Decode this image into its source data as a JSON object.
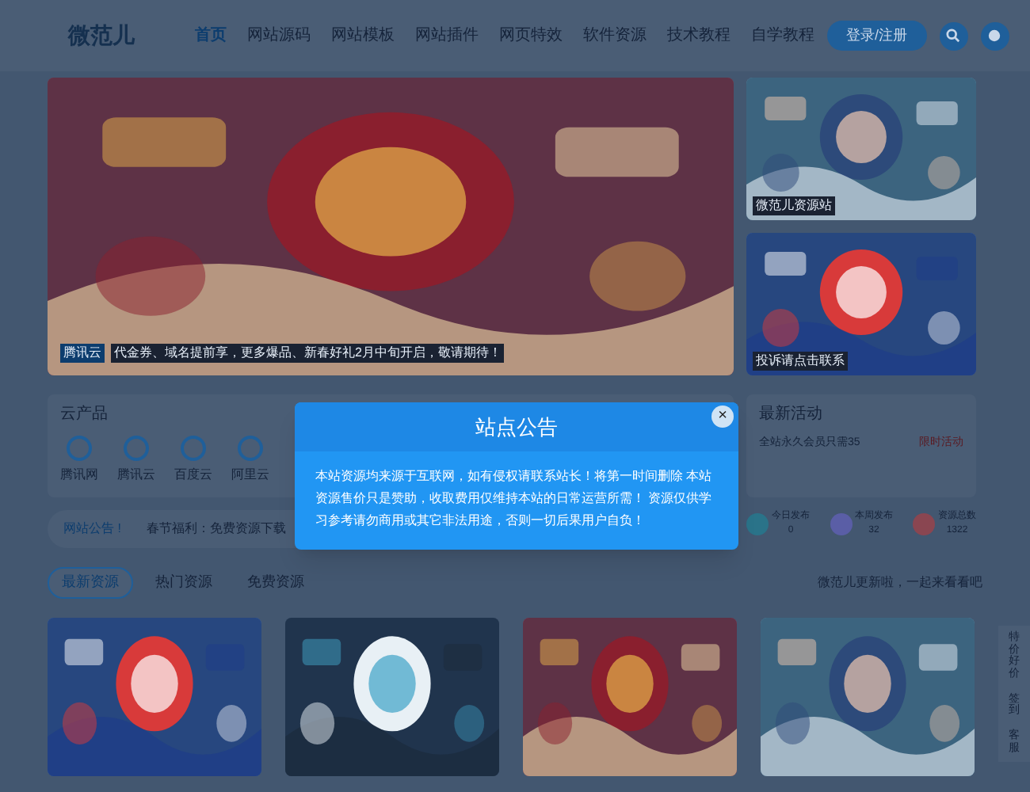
{
  "header": {
    "logo": "微范儿",
    "nav": [
      {
        "label": "首页",
        "selected": true
      },
      {
        "label": "网站源码",
        "selected": false
      },
      {
        "label": "网站模板",
        "selected": false
      },
      {
        "label": "网站插件",
        "selected": false
      },
      {
        "label": "网页特效",
        "selected": false
      },
      {
        "label": "软件资源",
        "selected": false
      },
      {
        "label": "技术教程",
        "selected": false
      },
      {
        "label": "自学教程",
        "selected": false
      }
    ],
    "login": "登录/注册"
  },
  "banner": {
    "badge": "腾讯云",
    "caption": "代金券、域名提前享，更多爆品、新春好礼2月中旬开启，敬请期待！"
  },
  "side_banners": [
    {
      "caption": "微范儿资源站"
    },
    {
      "caption": "投诉请点击联系"
    }
  ],
  "cloud": {
    "title": "云产品",
    "items": [
      {
        "label": "腾讯网"
      },
      {
        "label": "腾讯云"
      },
      {
        "label": "百度云"
      },
      {
        "label": "阿里云"
      }
    ]
  },
  "notice": {
    "label": "网站公告",
    "mark": "!",
    "text": "春节福利：免费资源下载"
  },
  "activity": {
    "title": "最新活动",
    "text": "全站永久会员只需35",
    "tag": "限时活动"
  },
  "stats": [
    {
      "label": "今日发布",
      "value": "0",
      "color": "#2a7389"
    },
    {
      "label": "本周发布",
      "value": "32",
      "color": "#5a5ea6"
    },
    {
      "label": "资源总数",
      "value": "1322",
      "color": "#8a4651"
    }
  ],
  "tabs": [
    {
      "label": "最新资源",
      "selected": true
    },
    {
      "label": "热门资源",
      "selected": false
    },
    {
      "label": "免费资源",
      "selected": false
    }
  ],
  "update_note": "微范儿更新啦，一起来看看吧",
  "float_bar": [
    {
      "label": "特价好价"
    },
    {
      "label": "签到"
    },
    {
      "label": "客服"
    }
  ],
  "modal": {
    "title": "站点公告",
    "body": "本站资源均来源于互联网，如有侵权请联系站长！将第一时间删除 本站资源售价只是赞助，收取费用仅维持本站的日常运营所需！ 资源仅供学习参考请勿商用或其它非法用途，否则一切后果用户自负！",
    "close": "×"
  }
}
